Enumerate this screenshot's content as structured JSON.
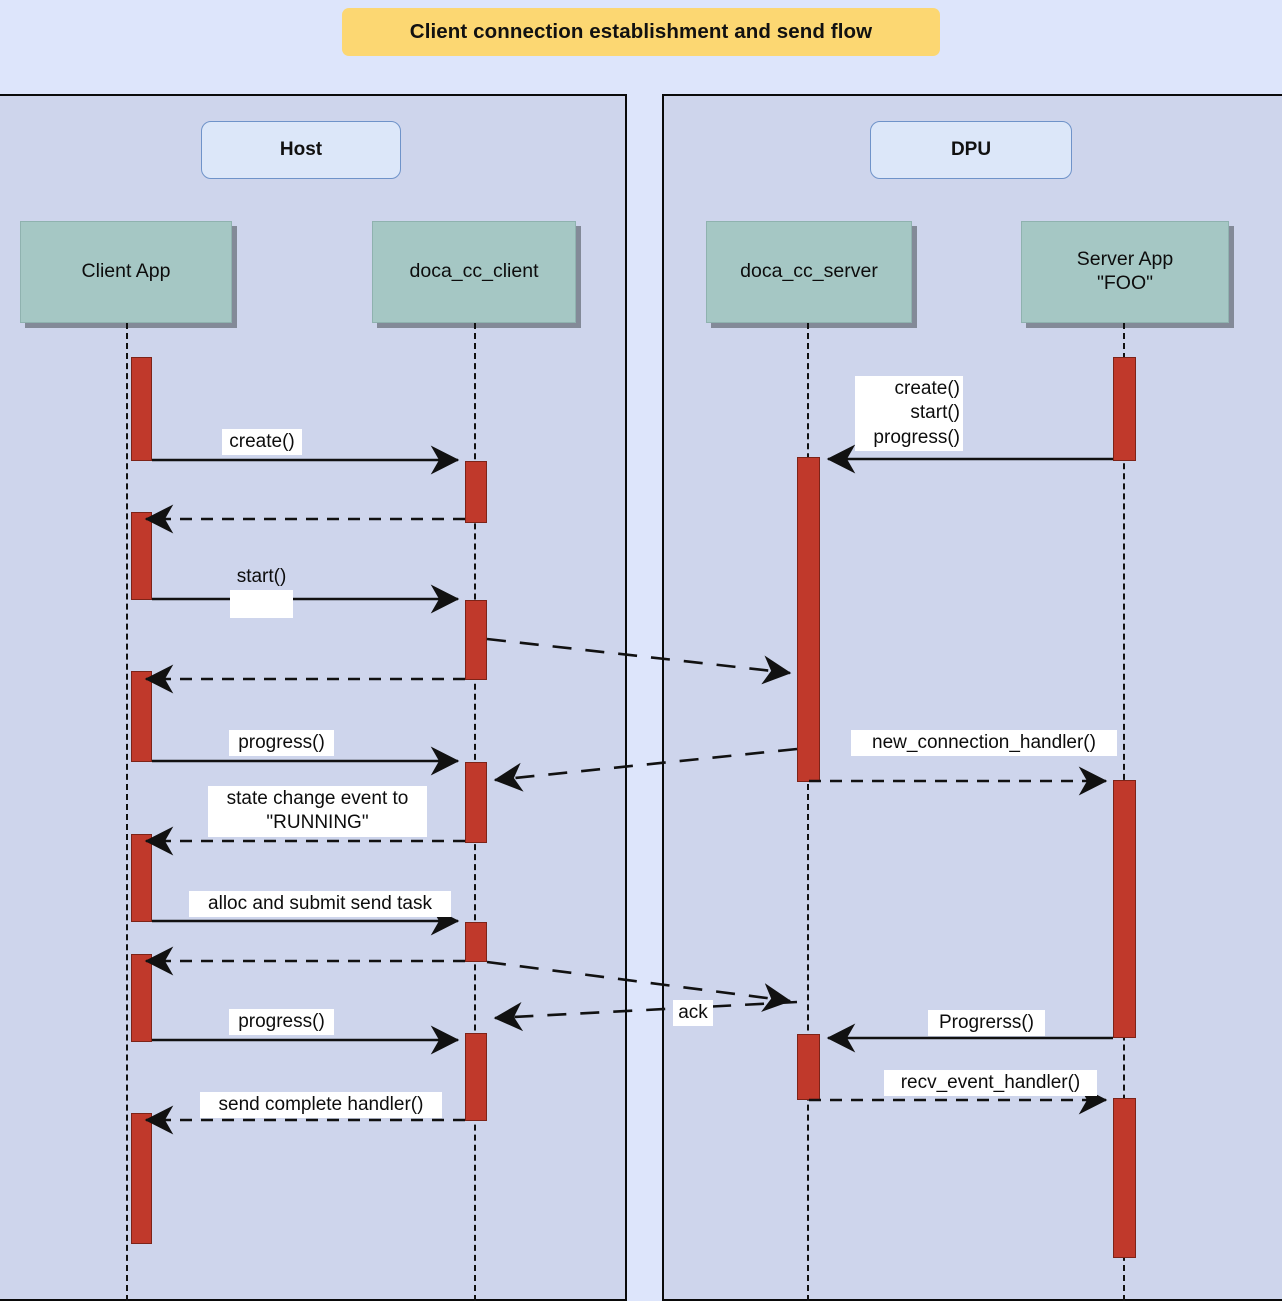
{
  "title": "Client connection establishment and send flow",
  "colors": {
    "page_background": "#dde5fb",
    "group_background": "#ced5ec",
    "group_border": "#0a0a0a",
    "title_banner": "#fcd772",
    "group_label_fill": "#dce7f9",
    "group_label_border": "#6f93c9",
    "participant_fill": "#a5c7c4",
    "activation_fill": "#c0392b",
    "activation_border": "#7d2318",
    "line": "#111111",
    "label_background": "#ffffff"
  },
  "groups": [
    {
      "id": "host",
      "label": "Host"
    },
    {
      "id": "dpu",
      "label": "DPU"
    }
  ],
  "participants": [
    {
      "id": "client-app",
      "label": "Client App",
      "group": "host"
    },
    {
      "id": "doca-client",
      "label": "doca_cc_client",
      "group": "host"
    },
    {
      "id": "doca-server",
      "label": "doca_cc_server",
      "group": "dpu"
    },
    {
      "id": "server-app",
      "label": "Server App\n\"FOO\"",
      "group": "dpu"
    }
  ],
  "messages": [
    {
      "id": "m1",
      "label": "create()\nstart()\nprogress()",
      "from": "server-app",
      "to": "doca-server",
      "style": "solid",
      "align": "right"
    },
    {
      "id": "m2",
      "label": "create()",
      "from": "client-app",
      "to": "doca-client",
      "style": "solid",
      "align": "center"
    },
    {
      "id": "m3",
      "label": "",
      "from": "doca-client",
      "to": "client-app",
      "style": "dashed",
      "align": "center"
    },
    {
      "id": "m4",
      "label": "start()",
      "from": "client-app",
      "to": "doca-client",
      "style": "solid",
      "align": "center"
    },
    {
      "id": "m5",
      "label": "",
      "from": "doca-client",
      "to": "doca-server",
      "style": "dashed",
      "align": "center"
    },
    {
      "id": "m6",
      "label": "",
      "from": "doca-client",
      "to": "client-app",
      "style": "dashed",
      "align": "center"
    },
    {
      "id": "m7",
      "label": "progress()",
      "from": "client-app",
      "to": "doca-client",
      "style": "solid",
      "align": "center"
    },
    {
      "id": "m8",
      "label": "",
      "from": "doca-server",
      "to": "doca-client",
      "style": "dashed",
      "align": "center"
    },
    {
      "id": "m9",
      "label": "new_connection_handler()",
      "from": "doca-server",
      "to": "server-app",
      "style": "dashed",
      "align": "center"
    },
    {
      "id": "m10",
      "label": "state change event to\n\"RUNNING\"",
      "from": "doca-client",
      "to": "client-app",
      "style": "dashed",
      "align": "center"
    },
    {
      "id": "m11",
      "label": "alloc and submit send task",
      "from": "client-app",
      "to": "doca-client",
      "style": "solid",
      "align": "center"
    },
    {
      "id": "m12",
      "label": "",
      "from": "doca-client",
      "to": "client-app",
      "style": "dashed",
      "align": "center"
    },
    {
      "id": "m13",
      "label": "ack",
      "from": "doca-client",
      "to": "doca-server",
      "style": "dashed",
      "align": "center"
    },
    {
      "id": "m14",
      "label": "",
      "from": "doca-server",
      "to": "doca-client",
      "style": "dashed",
      "align": "center"
    },
    {
      "id": "m15",
      "label": "progress()",
      "from": "client-app",
      "to": "doca-client",
      "style": "solid",
      "align": "center"
    },
    {
      "id": "m16",
      "label": "Progrerss()",
      "from": "server-app",
      "to": "doca-server",
      "style": "solid",
      "align": "center"
    },
    {
      "id": "m17",
      "label": "recv_event_handler()",
      "from": "doca-server",
      "to": "server-app",
      "style": "dashed",
      "align": "center"
    },
    {
      "id": "m18",
      "label": "send complete handler()",
      "from": "doca-client",
      "to": "client-app",
      "style": "dashed",
      "align": "center"
    }
  ]
}
